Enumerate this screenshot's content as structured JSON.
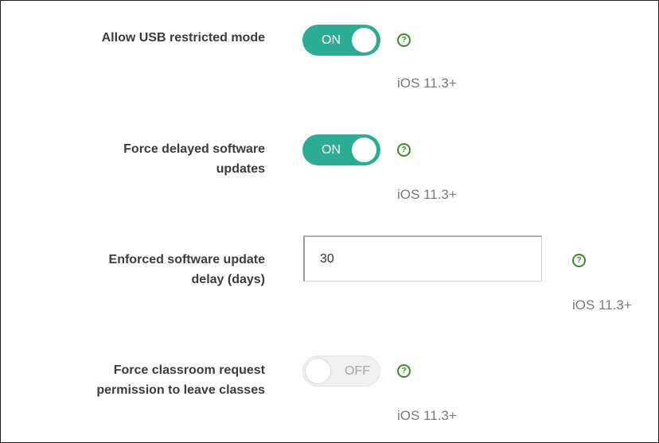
{
  "settings": [
    {
      "label_lines": [
        "Allow USB restricted mode"
      ],
      "control": "toggle",
      "state": "ON",
      "version": "iOS 11.3+"
    },
    {
      "label_lines": [
        "Force delayed software",
        "updates"
      ],
      "control": "toggle",
      "state": "ON",
      "version": "iOS 11.3+"
    },
    {
      "label_lines": [
        "Enforced software update",
        "delay (days)"
      ],
      "control": "text-input",
      "value": "30",
      "version": "iOS 11.3+"
    },
    {
      "label_lines": [
        "Force classroom request",
        "permission to leave classes"
      ],
      "control": "toggle",
      "state": "OFF",
      "version": "iOS 11.3+"
    }
  ],
  "help_glyph": "?",
  "icons": {
    "help": "question-circle-icon"
  },
  "colors": {
    "toggle_on": "#2bac94",
    "toggle_off": "#f1f1f1",
    "help_icon": "#3e8a27",
    "label_text": "#3c3c3c",
    "version_text": "#7a7a7a"
  }
}
